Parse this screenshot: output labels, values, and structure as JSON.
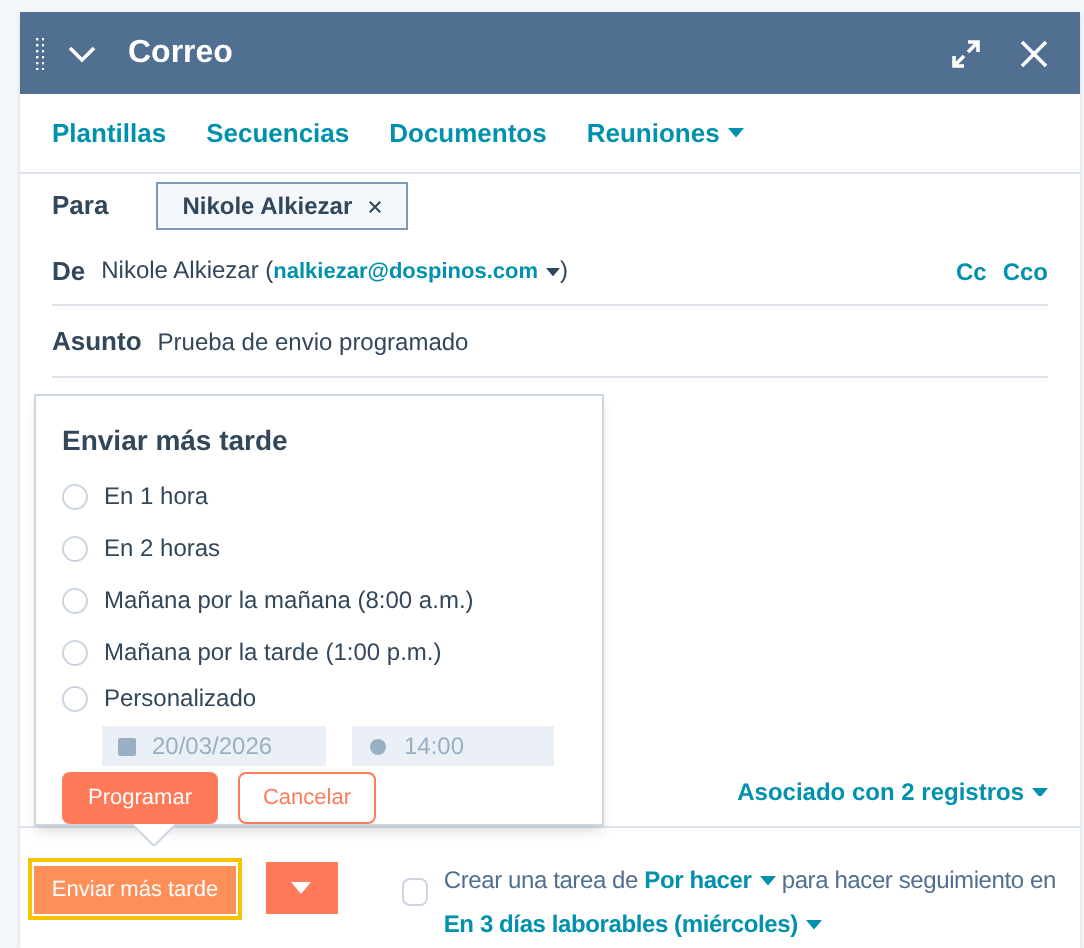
{
  "window": {
    "title": "Correo"
  },
  "tabs": [
    {
      "label": "Plantillas",
      "dropdown": false
    },
    {
      "label": "Secuencias",
      "dropdown": false
    },
    {
      "label": "Documentos",
      "dropdown": false
    },
    {
      "label": "Reuniones",
      "dropdown": true
    }
  ],
  "fields": {
    "to_label": "Para",
    "to_chip": "Nikole Alkiezar",
    "from_label": "De",
    "from_name": "Nikole Alkiezar (",
    "from_email": "nalkiezar@dospinos.com",
    "from_close": ")",
    "cc": "Cc",
    "bcc": "Cco",
    "subject_label": "Asunto",
    "subject": "Prueba de envio programado"
  },
  "associated": "Asociado con 2 registros",
  "popover": {
    "title": "Enviar más tarde",
    "options": [
      {
        "label": "En 1 hora",
        "selected": false
      },
      {
        "label": "En 2 horas",
        "selected": false
      },
      {
        "label": "Mañana por la mañana (8:00 a.m.)",
        "selected": false
      },
      {
        "label": "Mañana por la tarde (1:00 p.m.)",
        "selected": false
      },
      {
        "label": "Personalizado",
        "selected": false
      }
    ],
    "date": "20/03/2026",
    "time": "14:00",
    "confirm": "Programar",
    "cancel": "Cancelar"
  },
  "footer": {
    "send_button": "Enviar más tarde",
    "highlighted": true,
    "task_checked": false,
    "task_text_1": "Crear una tarea de",
    "task_type": "Por hacer",
    "task_text_2": "para hacer seguimiento en",
    "task_when": "En 3 días laborables (miércoles)"
  }
}
